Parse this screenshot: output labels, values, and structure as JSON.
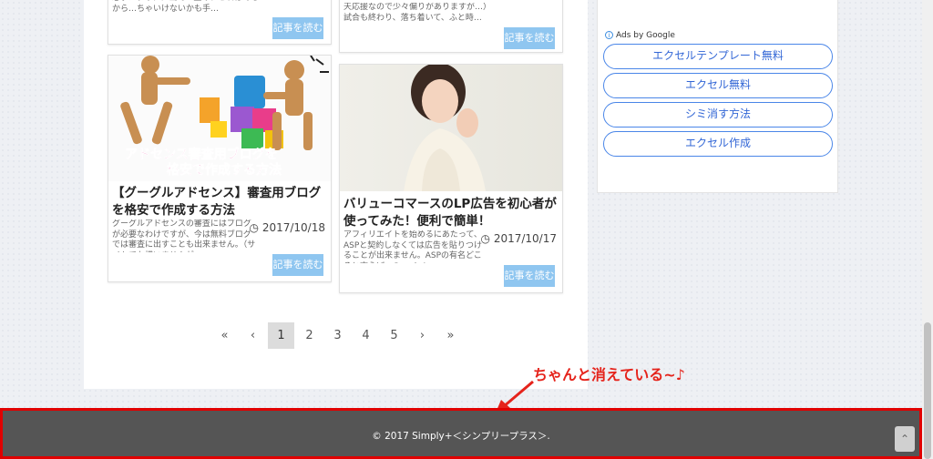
{
  "cards_top": [
    {
      "excerpt": "必ずメディアに出て…並み、これはあるから…ちゃいけないかも手…",
      "readmore": "記事を読む"
    },
    {
      "excerpt": "天応援なので少々偏りがありますが…）試合も終わり、落ち着いて、ふと時…",
      "readmore": "記事を読む"
    }
  ],
  "cards": [
    {
      "thumb_caption_line1": "アドセンス審査用ブログを",
      "thumb_caption_line2": "格安で作成する方法",
      "title": "【グーグルアドセンス】審査用ブログを格安で作成する方法",
      "date": "2017/10/18",
      "excerpt": "グーグルアドセンスの審査にはブログが必要なわけですが、今は無料ブログでは審査に出すことも出来ません。（サイトでも構いませんが…",
      "readmore": "記事を読む"
    },
    {
      "title": "バリューコマースのLP広告を初心者が使ってみた！便利で簡単！",
      "date": "2017/10/17",
      "excerpt": "アフィリエイトを始めるにあたって、ASPと契約しなくては広告を貼りつけることが出来ません。ASPの有名どころと言えば、GoogleA…",
      "readmore": "記事を読む"
    }
  ],
  "sidebar": {
    "ads_label": "Ads by Google",
    "ad_links": [
      "エクセルテンプレート無料",
      "エクセル無料",
      "シミ消す方法",
      "エクセル作成"
    ]
  },
  "pagination": [
    "«",
    "‹",
    "1",
    "2",
    "3",
    "4",
    "5",
    "›",
    "»"
  ],
  "annotation": "ちゃんと消えている~♪",
  "footer": {
    "copyright": "© 2017 Simply+＜シンプリープラス＞."
  },
  "colors": {
    "accent": "#8fc6f0",
    "footer_bg": "#555555",
    "annotation": "#e5231b",
    "ad_border": "#4a86e8"
  }
}
